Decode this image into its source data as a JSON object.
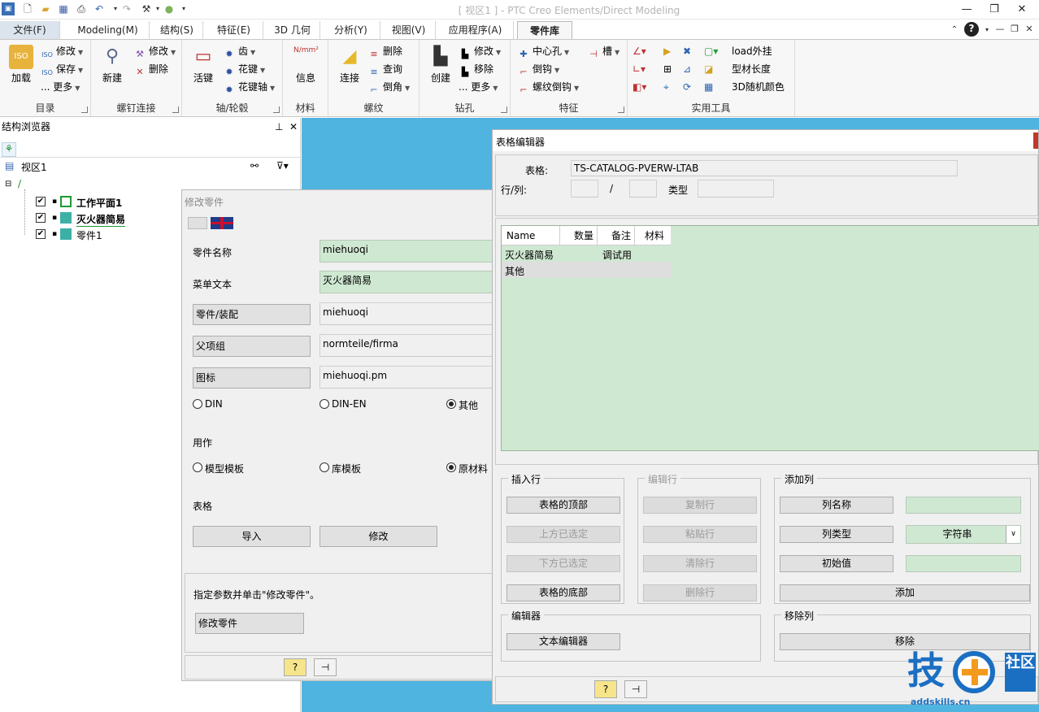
{
  "window": {
    "title": "[ 视区1 ] - PTC Creo Elements/Direct Modeling"
  },
  "quick_access": [
    "app-icon",
    "new-icon",
    "open-icon",
    "save-icon",
    "print-preview-icon",
    "undo-icon",
    "redo-icon",
    "tools-icon",
    "status-icon"
  ],
  "tabs": [
    {
      "label": "文件(F)"
    },
    {
      "label": "Modeling(M)"
    },
    {
      "label": "结构(S)"
    },
    {
      "label": "特征(E)"
    },
    {
      "label": "3D 几何"
    },
    {
      "label": "分析(Y)"
    },
    {
      "label": "视图(V)"
    },
    {
      "label": "应用程序(A)"
    },
    {
      "label": "零件库"
    }
  ],
  "ribbon": {
    "catalog": {
      "label": "目录",
      "load": "加载",
      "modify": "修改",
      "save": "保存",
      "more": "... 更多"
    },
    "bolt": {
      "label": "螺钉连接",
      "new": "新建",
      "modify": "修改",
      "delete": "删除"
    },
    "shaft": {
      "label": "轴/轮毂",
      "key": "活键",
      "gear": "齿",
      "spline": "花键",
      "spline_shaft": "花键轴"
    },
    "material": {
      "label": "材料",
      "info": "信息",
      "unit": "N/mm²"
    },
    "thread": {
      "label": "螺纹",
      "connect": "连接",
      "delete": "删除",
      "query": "查询",
      "chamfer": "倒角"
    },
    "drill": {
      "label": "钻孔",
      "create": "创建",
      "modify": "修改",
      "move": "移除",
      "more": "... 更多"
    },
    "feature": {
      "label": "特征",
      "center_hole": "中心孔",
      "chamfer": "倒钩",
      "thread_chamfer": "螺纹倒钩",
      "groove": "槽"
    },
    "tools": {
      "label": "实用工具",
      "load_plugin": "load外挂",
      "profile_length": "型材长度",
      "random_color": "3D随机颜色"
    }
  },
  "structure_browser": {
    "title": "结构浏览器",
    "root": "视区1",
    "items": [
      {
        "label": "工作平面1",
        "bold": true
      },
      {
        "label": "灭火器简易",
        "bold": true
      },
      {
        "label": "零件1",
        "bold": false
      }
    ]
  },
  "modify_part": {
    "title": "修改零件",
    "part_name_label": "零件名称",
    "part_name_value": "miehuoqi",
    "menu_text_label": "菜单文本",
    "menu_text_value": "灭火器简易",
    "part_assembly_button": "零件/装配",
    "part_assembly_value": "miehuoqi",
    "parent_group_button": "父项组",
    "parent_group_value": "normteile/firma",
    "icon_button": "图标",
    "icon_value": "miehuoqi.pm",
    "standards": [
      "DIN",
      "DIN-EN",
      "其他"
    ],
    "standard_selected": 2,
    "usage_label": "用作",
    "usage_options": [
      "模型模板",
      "库模板",
      "原材料"
    ],
    "usage_selected": 2,
    "table_label": "表格",
    "import_button": "导入",
    "modify_button": "修改",
    "hint": "指定参数并单击\"修改零件\"。",
    "modify_part_button": "修改零件"
  },
  "table_editor": {
    "title": "表格编辑器",
    "table_label": "表格:",
    "table_value": "TS-CATALOG-PVERW-LTAB",
    "rowcol_label": "行/列:",
    "slash": "/",
    "type_label": "类型",
    "columns": [
      "Name",
      "数量",
      "备注",
      "材料"
    ],
    "rows": [
      {
        "name": "灭火器简易",
        "qty": "",
        "note": "调试用",
        "material": ""
      },
      {
        "name": "其他",
        "qty": "",
        "note": "",
        "material": ""
      }
    ],
    "insert_row": {
      "legend": "插入行",
      "top": "表格的顶部",
      "above": "上方已选定",
      "below": "下方已选定",
      "bottom": "表格的底部"
    },
    "edit_row": {
      "legend": "编辑行",
      "copy": "复制行",
      "paste": "粘贴行",
      "clear": "清除行",
      "delete": "删除行"
    },
    "add_column": {
      "legend": "添加列",
      "col_name": "列名称",
      "col_type": "列类型",
      "col_type_value": "字符串",
      "init_value": "初始值",
      "add": "添加"
    },
    "editor": {
      "legend": "编辑器",
      "text_editor": "文本编辑器"
    },
    "remove_column": {
      "legend": "移除列",
      "remove": "移除"
    }
  },
  "watermark": {
    "main": "技",
    "side": "社区",
    "url": "addskills.cn"
  },
  "colors": {
    "viewport": "#4fb4e0",
    "field_green": "#cfe8d2",
    "watermark_blue": "#1b6fc2",
    "watermark_orange": "#f39a1d"
  }
}
